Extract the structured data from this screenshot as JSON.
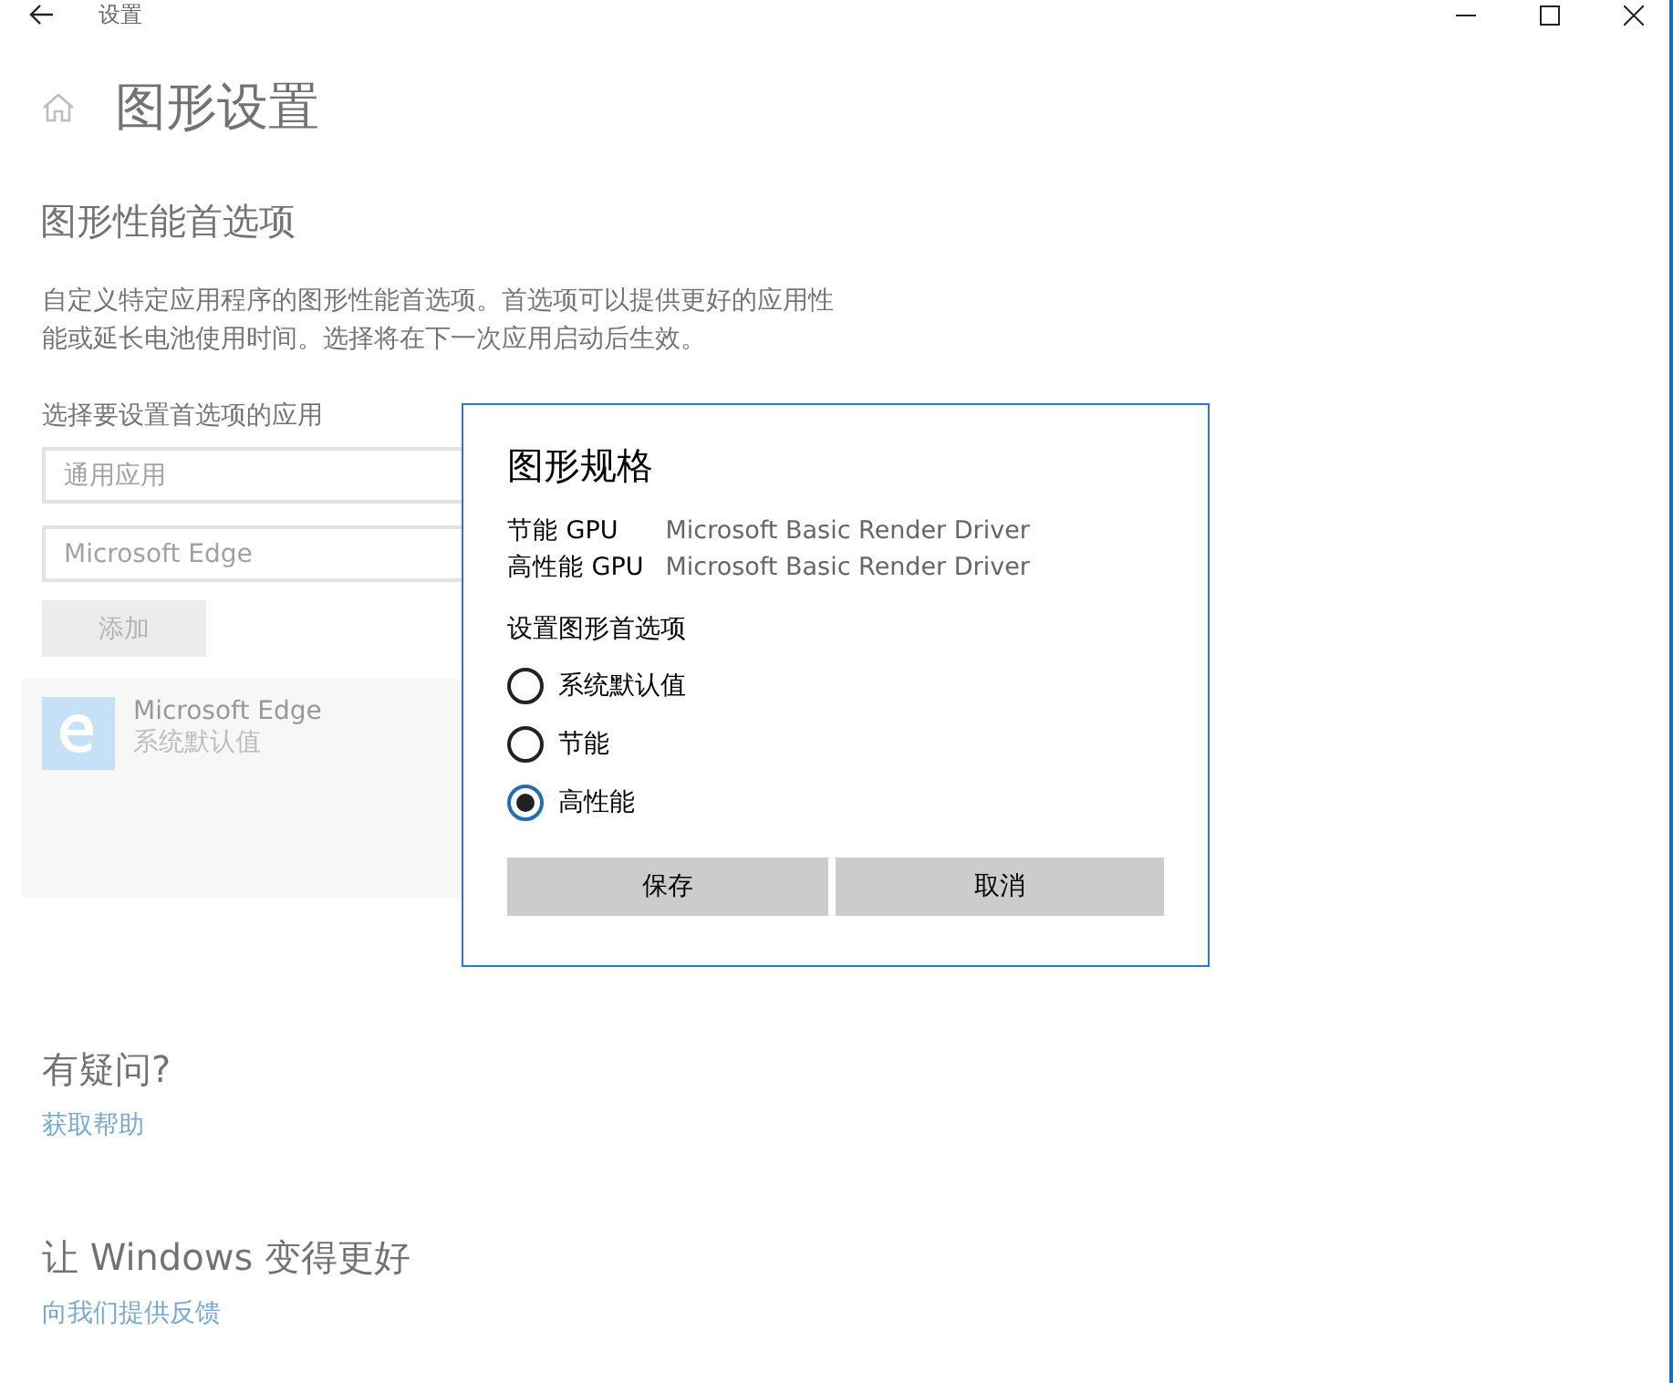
{
  "window": {
    "title": "设置"
  },
  "page": {
    "title": "图形设置",
    "section_title": "图形性能首选项",
    "description": "自定义特定应用程序的图形性能首选项。首选项可以提供更好的应用性能或延长电池使用时间。选择将在下一次应用启动后生效。",
    "app_picker_label": "选择要设置首选项的应用",
    "app_type_dropdown": {
      "value": "通用应用"
    },
    "app_dropdown": {
      "value": "Microsoft Edge"
    },
    "add_button": {
      "label": "添加",
      "disabled": true
    },
    "apps": [
      {
        "name": "Microsoft Edge",
        "preference": "系统默认值"
      }
    ]
  },
  "help": {
    "title": "有疑问?",
    "link": "获取帮助"
  },
  "feedback": {
    "title": "让 Windows 变得更好",
    "link": "向我们提供反馈"
  },
  "dialog": {
    "title": "图形规格",
    "specs": [
      {
        "label": "节能 GPU",
        "value": "Microsoft Basic Render Driver"
      },
      {
        "label": "高性能 GPU",
        "value": "Microsoft Basic Render Driver"
      }
    ],
    "options_label": "设置图形首选项",
    "options": [
      {
        "label": "系统默认值",
        "selected": false
      },
      {
        "label": "节能",
        "selected": false
      },
      {
        "label": "高性能",
        "selected": true
      }
    ],
    "buttons": [
      "保存",
      "取消"
    ]
  }
}
